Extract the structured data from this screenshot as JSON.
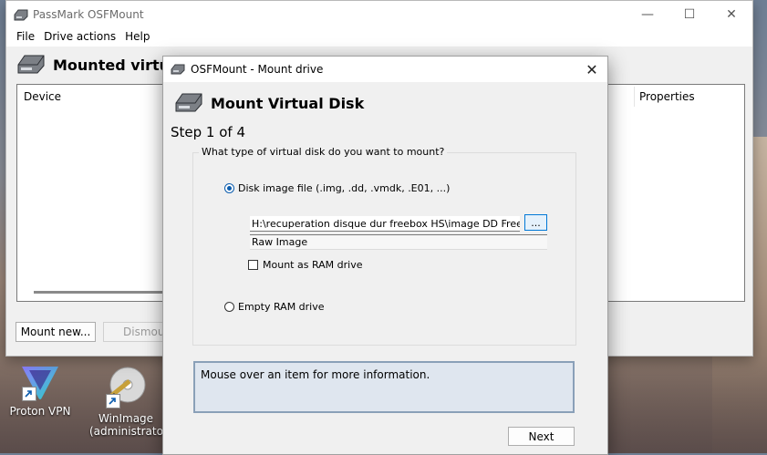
{
  "desktop": {
    "icons": [
      {
        "label": "Proton VPN"
      },
      {
        "label": "WinImage (administrator)"
      }
    ]
  },
  "main_window": {
    "title": "PassMark OSFMount",
    "menu": [
      "File",
      "Drive actions",
      "Help"
    ],
    "heading": "Mounted virtual",
    "columns": {
      "device": "Device",
      "properties": "Properties"
    },
    "buttons": {
      "mount_new": "Mount new...",
      "dismount": "Dismount"
    },
    "controls": {
      "minimize": "—",
      "maximize": "☐",
      "close": "✕"
    }
  },
  "dialog": {
    "title": "OSFMount - Mount drive",
    "heading": "Mount Virtual Disk",
    "step": "Step 1 of 4",
    "group_title": "What type of virtual disk do you want to mount?",
    "option_disk_image": "Disk image file (.img, .dd, .vmdk, .E01, ...)",
    "option_disk_image_selected": true,
    "image_path": "H:\\recuperation disque dur freebox HS\\image DD Freebox\\Vi",
    "browse_label": "...",
    "image_type": "Raw Image",
    "mount_as_ram_label": "Mount as RAM drive",
    "mount_as_ram_checked": false,
    "option_empty_ram": "Empty RAM drive",
    "info_text": "Mouse over an item for more information.",
    "next_label": "Next",
    "close": "✕"
  }
}
